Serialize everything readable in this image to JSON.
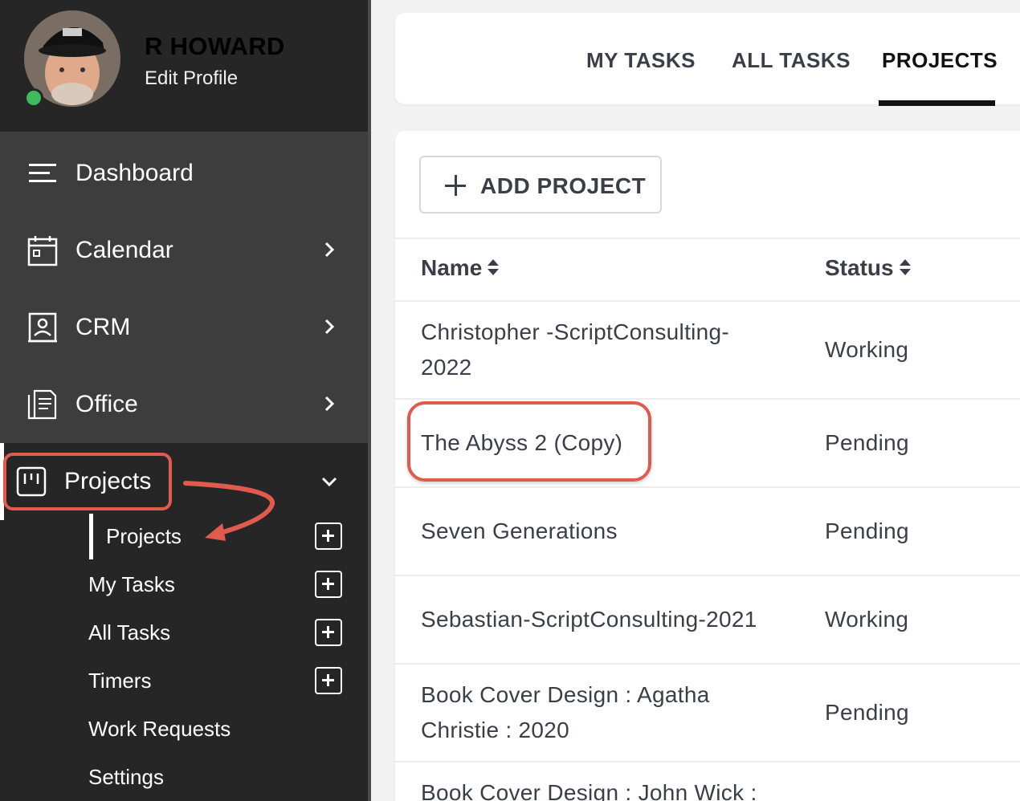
{
  "profile": {
    "name": "R HOWARD",
    "edit_label": "Edit Profile"
  },
  "nav": {
    "dashboard": "Dashboard",
    "calendar": "Calendar",
    "crm": "CRM",
    "office": "Office",
    "projects": "Projects"
  },
  "submenu": {
    "projects": "Projects",
    "my_tasks": "My Tasks",
    "all_tasks": "All Tasks",
    "timers": "Timers",
    "work_requests": "Work Requests",
    "settings": "Settings"
  },
  "tabs": {
    "my_tasks": "MY TASKS",
    "all_tasks": "ALL TASKS",
    "projects": "PROJECTS",
    "active": "projects"
  },
  "toolbar": {
    "add_project": "ADD PROJECT"
  },
  "table": {
    "columns": {
      "name": "Name",
      "status": "Status"
    },
    "rows": [
      {
        "name": "Christopher -ScriptConsulting-2022",
        "status": "Working"
      },
      {
        "name": "The Abyss 2 (Copy)",
        "status": "Pending"
      },
      {
        "name": "Seven Generations",
        "status": "Pending"
      },
      {
        "name": "Sebastian-ScriptConsulting-2021",
        "status": "Working"
      },
      {
        "name": "Book Cover Design : Agatha Christie : 2020",
        "status": "Pending"
      },
      {
        "name": "Book Cover Design : John Wick :",
        "status": ""
      }
    ]
  },
  "colors": {
    "sidebar": "#262626",
    "nav_block": "#3d3d3d",
    "highlight": "#e05a4e",
    "online": "#3dbb5d"
  }
}
